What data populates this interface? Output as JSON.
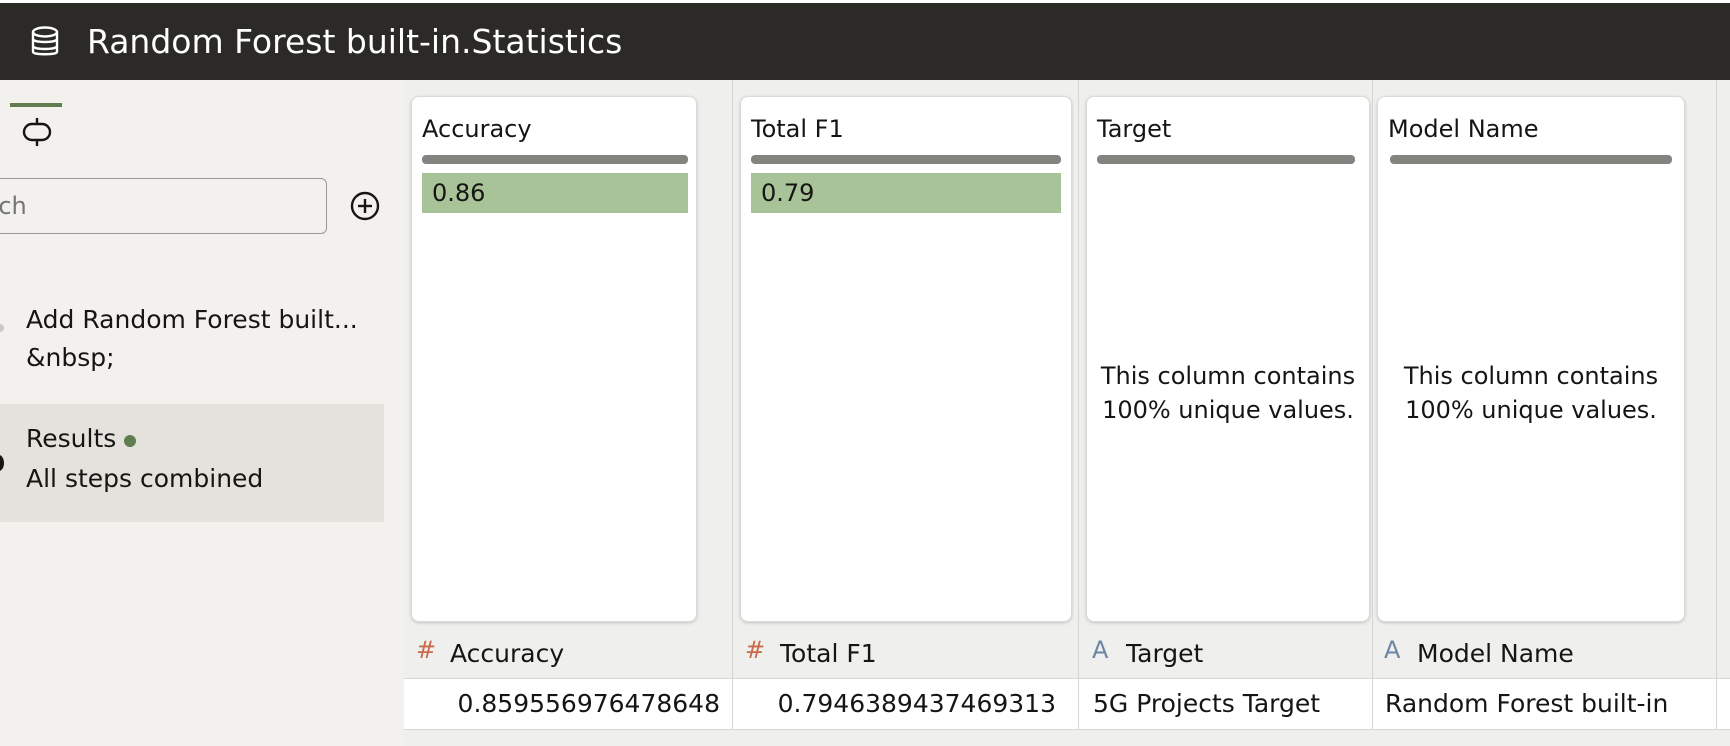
{
  "header": {
    "title": "Random Forest built-in.Statistics",
    "icon": "database-icon",
    "background": "#2b2a27"
  },
  "left_panel": {
    "tab_icon": "steps-icon",
    "search": {
      "value": "",
      "placeholder": "rch"
    },
    "add_icon": "add-circle-icon",
    "steps": [
      {
        "title": "Add Random Forest built...",
        "subtitle": "&nbsp;"
      }
    ],
    "results": {
      "label": "Results",
      "subtitle": "All steps combined",
      "status_color": "#5f7d4f"
    }
  },
  "columns": [
    {
      "name": "Accuracy",
      "type_icon": "#",
      "type": "number",
      "summary_value": "0.86",
      "cell": "0.859556976478648"
    },
    {
      "name": "Total F1",
      "type_icon": "#",
      "type": "number",
      "summary_value": "0.79",
      "cell": "0.7946389437469313"
    },
    {
      "name": "Target",
      "type_icon": "A",
      "type": "text",
      "summary_note": "This column contains 100% unique values.",
      "cell": "5G Projects Target"
    },
    {
      "name": "Model Name",
      "type_icon": "A",
      "type": "text",
      "summary_note": "This column contains 100% unique values.",
      "cell": "Random Forest built-in"
    }
  ],
  "colors": {
    "value_bar": "#a9c399",
    "accent_green": "#5f7d4f",
    "number_type": "#c96a4a",
    "text_type": "#6b86a6"
  }
}
